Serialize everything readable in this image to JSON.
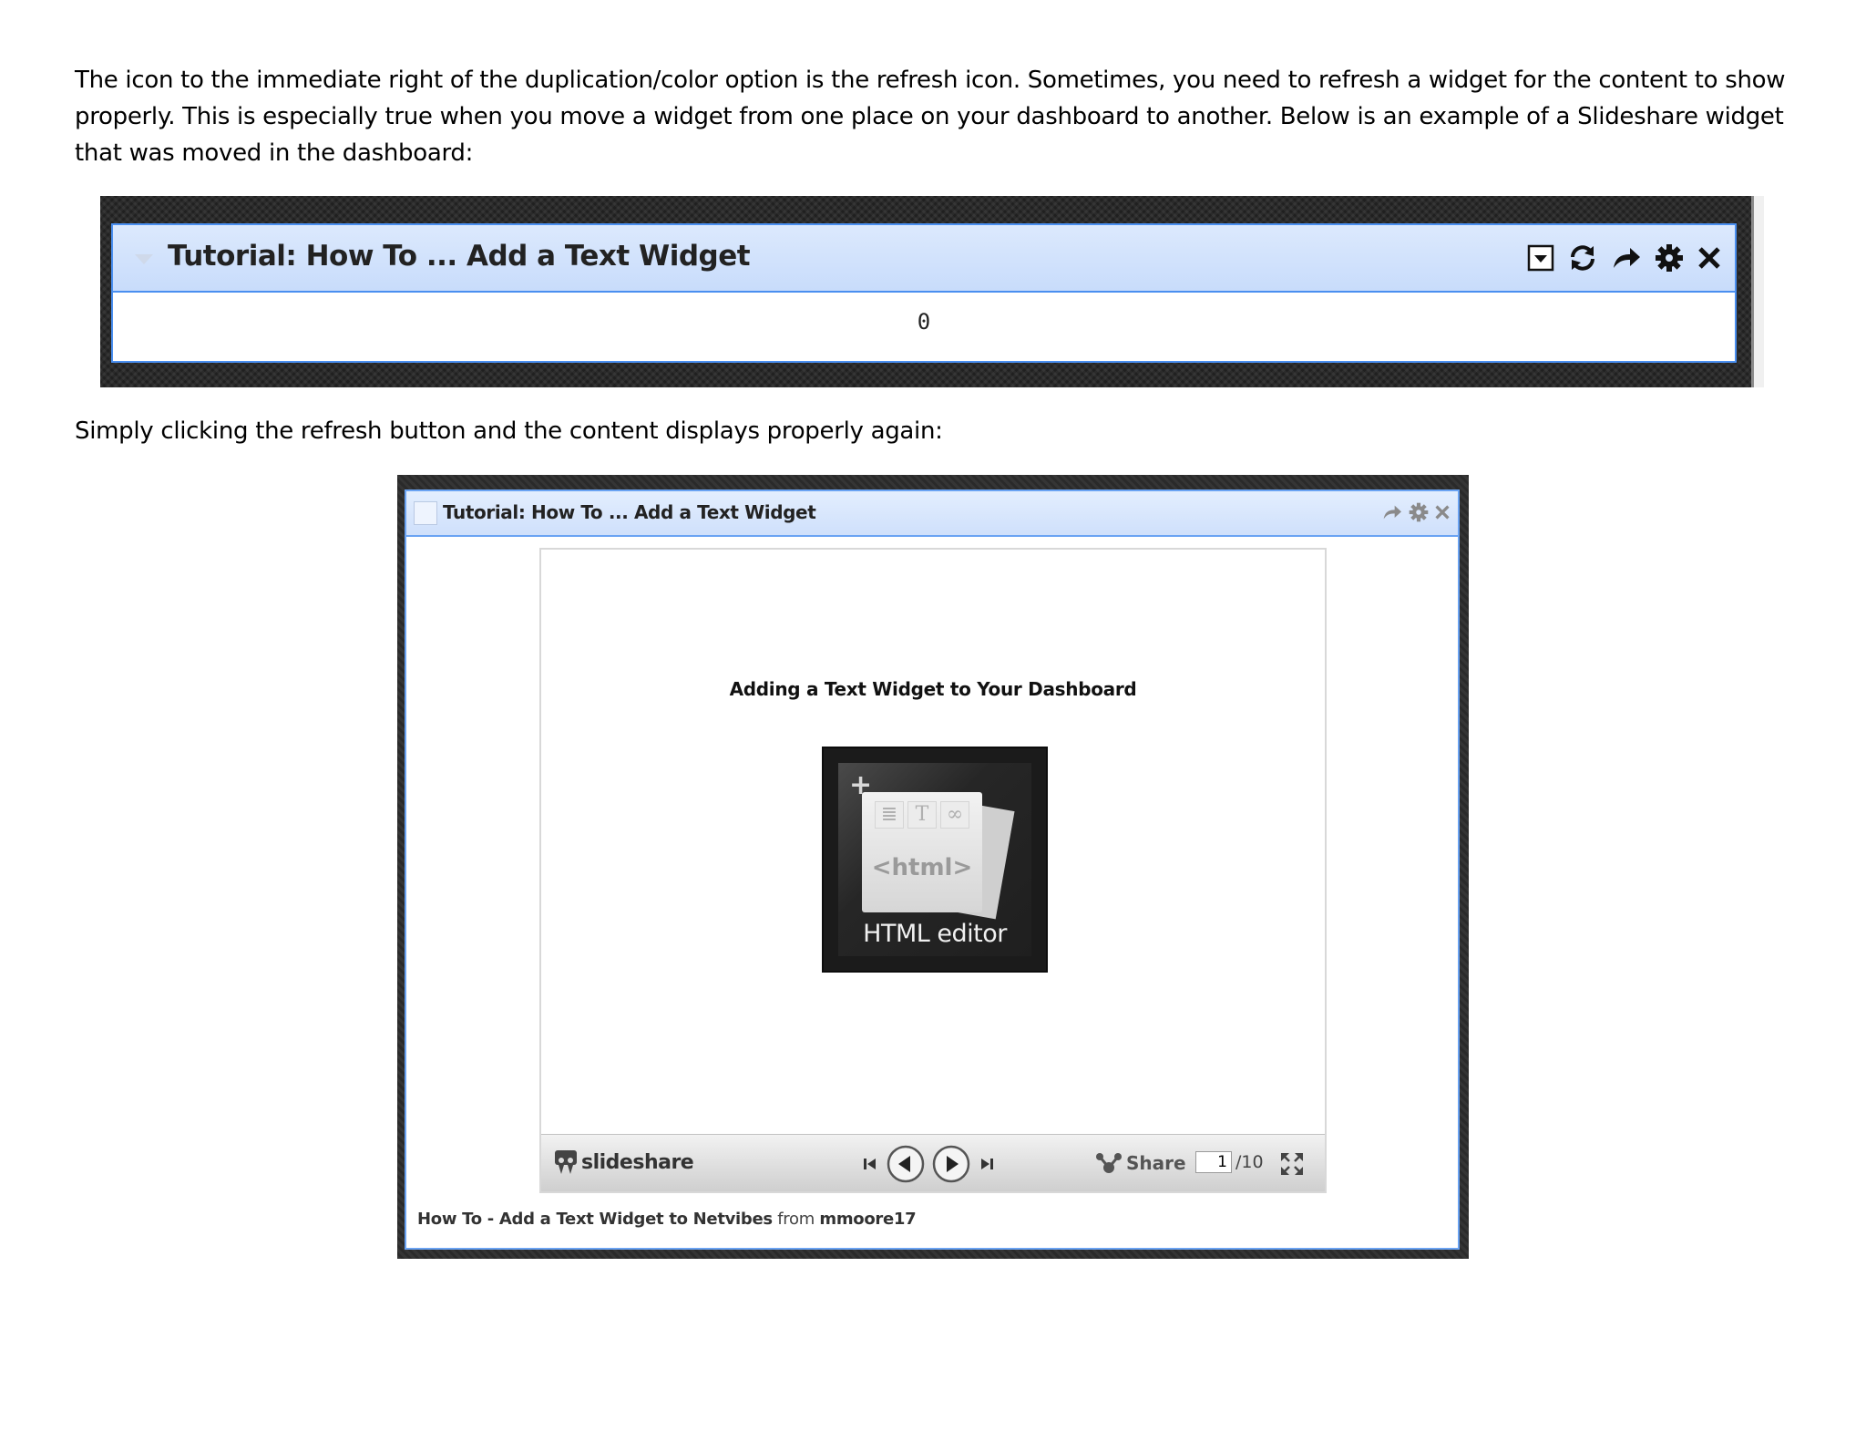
{
  "paragraph1": "The icon to the immediate right of the duplication/color option is the refresh icon. Sometimes, you need to refresh a widget for the content to show properly. This is especially true when you move a widget from one place on your dashboard to another. Below is an example of a Slideshare widget that was moved in the dashboard:",
  "paragraph2": "Simply clicking the refresh button and the content displays properly again:",
  "widget_broken": {
    "title": "Tutorial: How To ... Add a Text Widget",
    "body_value": "0",
    "icons": [
      "dropdown-icon",
      "refresh-icon",
      "share-icon",
      "gear-icon",
      "close-icon"
    ]
  },
  "widget_fixed": {
    "title": "Tutorial: How To ... Add a Text Widget",
    "icons": [
      "share-icon",
      "gear-icon",
      "close-icon"
    ],
    "slide": {
      "title": "Adding a Text Widget to Your Dashboard",
      "tile_plus": "+",
      "tile_glyphs": [
        "≣",
        "T",
        "∞"
      ],
      "tile_code": "<html>",
      "tile_label": "HTML editor"
    },
    "player": {
      "logo": "slideshare",
      "share_label": "Share",
      "current_page": "1",
      "total_pages": "/10"
    },
    "caption": {
      "link": "How To - Add a Text Widget to Netvibes",
      "from": "from",
      "author": "mmoore17"
    }
  }
}
